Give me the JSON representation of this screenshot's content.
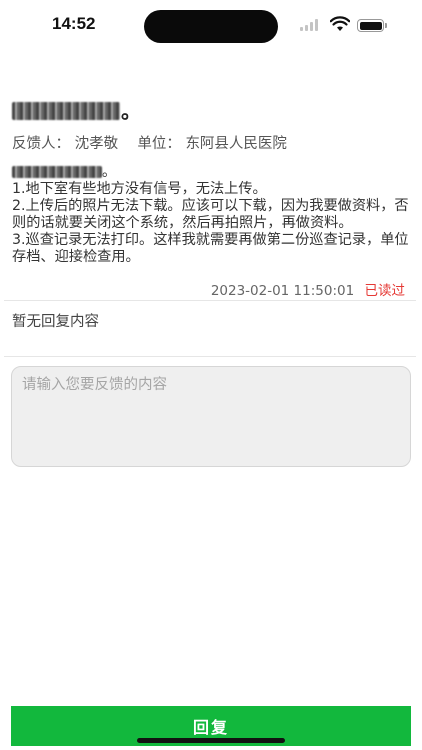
{
  "status_bar": {
    "time": "14:52",
    "icons": [
      "signal-icon",
      "wifi-icon",
      "battery-icon"
    ]
  },
  "feedback": {
    "title_suffix": "。",
    "submitter_label": "反馈人：",
    "submitter_name": "沈孝敬",
    "unit_label": "单位：",
    "unit_name": "东阿县人民医院",
    "greeting_suffix": "。",
    "lines": [
      "1.地下室有些地方没有信号，无法上传。",
      "2.上传后的照片无法下载。应该可以下载，因为我要做资料，否则的话就要关闭这个系统，然后再拍照片，再做资料。",
      "3.巡查记录无法打印。这样我就需要再做第二份巡查记录，单位存档、迎接检查用。"
    ],
    "timestamp": "2023-02-01 11:50:01",
    "read_status": "已读过"
  },
  "reply": {
    "empty_text": "暂无回复内容",
    "input_placeholder": "请输入您要反馈的内容",
    "input_value": "",
    "submit_label": "回复"
  },
  "colors": {
    "accent": "#12b83d",
    "read_status": "#e53935",
    "input_bg": "#efefef"
  }
}
